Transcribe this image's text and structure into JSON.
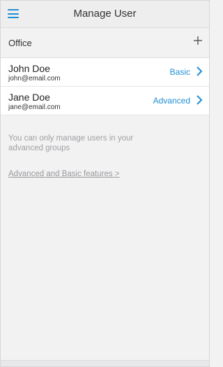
{
  "header": {
    "title": "Manage User"
  },
  "section": {
    "title": "Office"
  },
  "users": [
    {
      "name": "John Doe",
      "email": "john@email.com",
      "role": "Basic"
    },
    {
      "name": "Jane Doe",
      "email": "jane@email.com",
      "role": "Advanced"
    }
  ],
  "info": {
    "message": "You can only manage users in your advanced groups",
    "link_label": "Advanced and Basic features >"
  },
  "icons": {
    "menu": "hamburger-menu-icon",
    "add": "plus-icon",
    "chevron": "chevron-right-icon"
  },
  "colors": {
    "accent": "#1f8fd4",
    "background": "#f2f2f3",
    "muted_text": "#a0a0a3"
  }
}
